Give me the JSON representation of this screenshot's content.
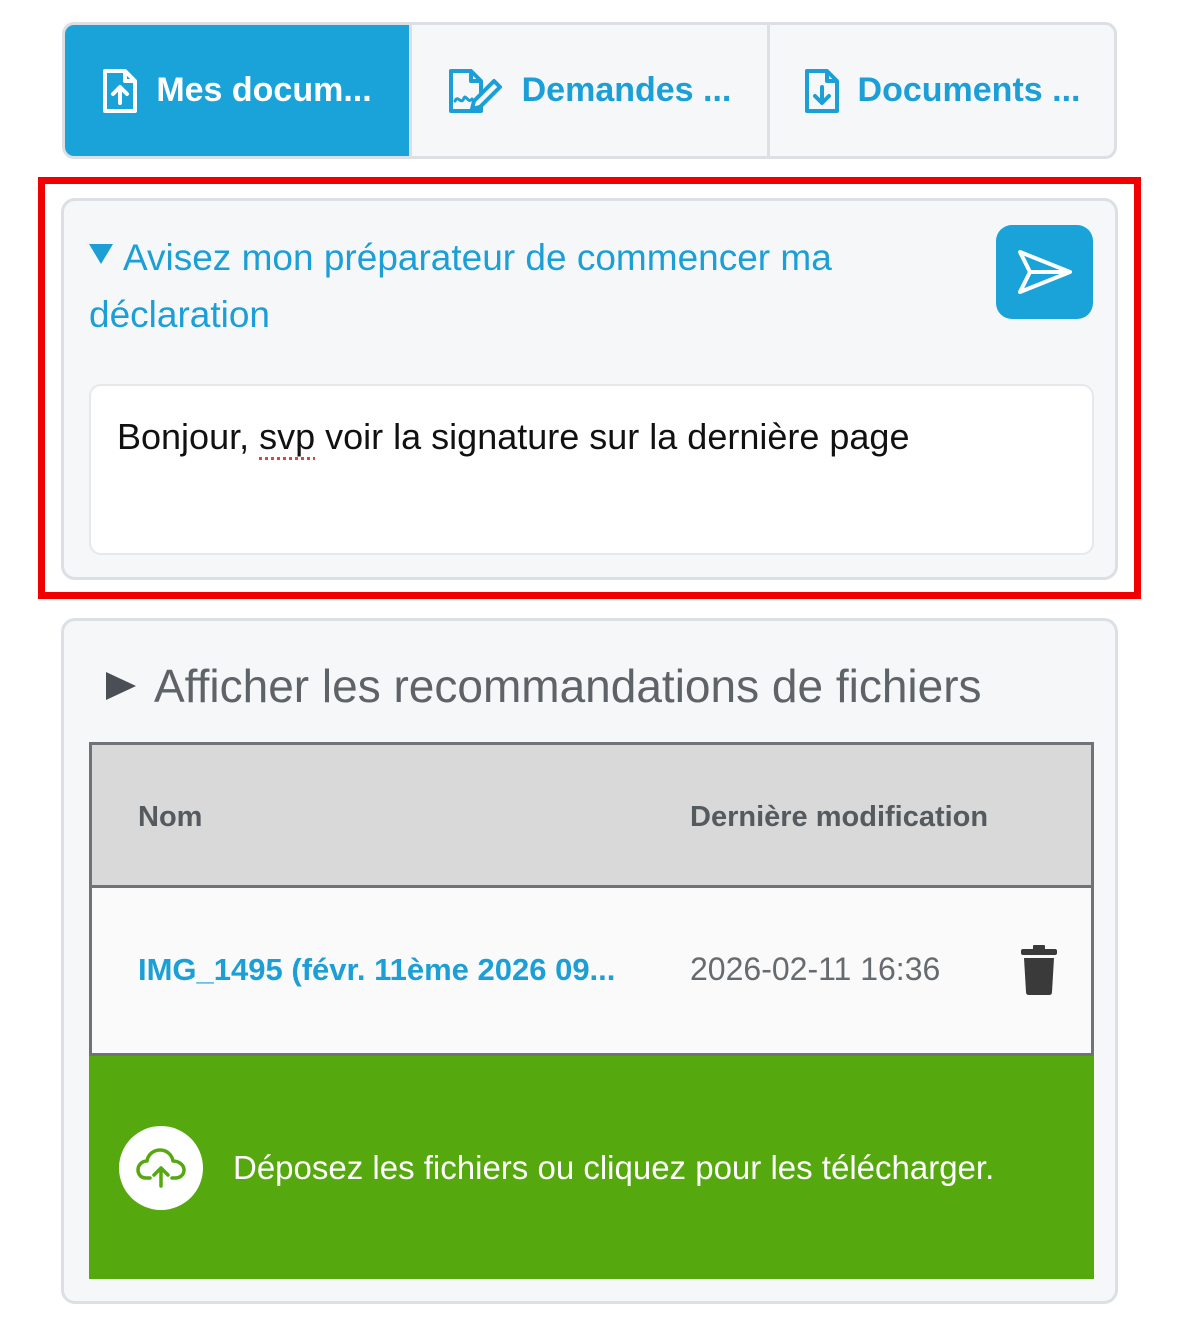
{
  "tabs": [
    {
      "label": "Mes docum...",
      "icon": "file-upload-icon",
      "active": true
    },
    {
      "label": "Demandes ...",
      "icon": "signature-request-icon",
      "active": false
    },
    {
      "label": "Documents ...",
      "icon": "file-download-icon",
      "active": false
    }
  ],
  "notify": {
    "title": "Avisez mon préparateur de commencer ma déclaration",
    "message_prefix": "Bonjour, ",
    "message_misspelled": "svp",
    "message_suffix": " voir la signature sur la dernière page",
    "send_icon": "paper-plane-icon"
  },
  "files": {
    "recommendations_label": "Afficher les recommandations de fichiers",
    "columns": {
      "name": "Nom",
      "modified": "Dernière modification"
    },
    "rows": [
      {
        "name": "IMG_1495 (févr. 11ème 2026 09...",
        "modified": "2026-02-11 16:36"
      }
    ],
    "upload_label": "Déposez les fichiers ou cliquez pour les télécharger."
  },
  "colors": {
    "accent": "#1aa3d9",
    "highlight": "#f00000",
    "upload": "#56a80f"
  }
}
